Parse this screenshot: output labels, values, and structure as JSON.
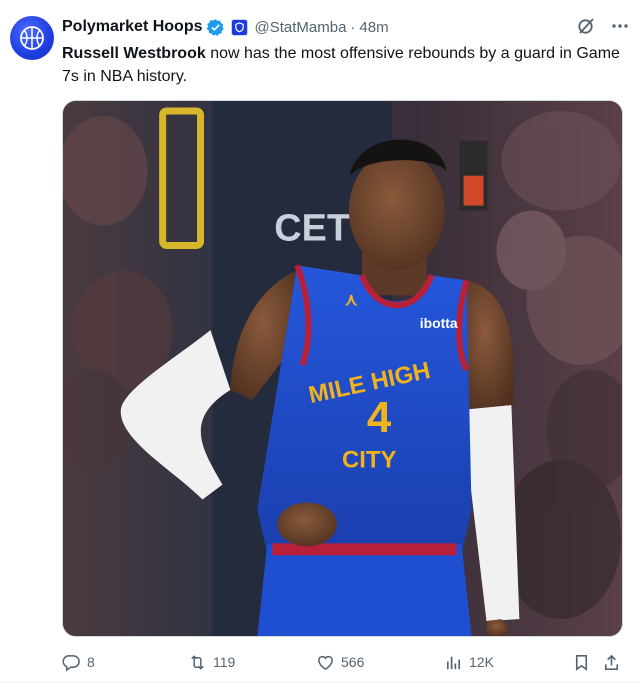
{
  "tweet": {
    "author": {
      "display_name": "Polymarket Hoops",
      "handle": "@StatMamba",
      "separator": "·",
      "time": "48m",
      "avatar_icon": "basketball-icon",
      "verified_icon": "verified-badge-icon",
      "affiliate_icon": "affiliate-badge-icon"
    },
    "text": {
      "mention": "Russell Westbrook",
      "rest": " now has the most offensive rebounds by a guard in Game 7s in NBA history."
    },
    "media": {
      "alt_icon": "photo",
      "jersey_line1": "MILE HIGH",
      "jersey_number": "4",
      "jersey_line2": "CITY",
      "jersey_sponsor": "ibotta",
      "banner_text": "CET"
    },
    "actions": {
      "replies": "8",
      "retweets": "119",
      "likes": "566",
      "views": "12K"
    },
    "colors": {
      "accent": "#1d9bf0",
      "muted": "#536471",
      "jersey_blue": "#1f4fd1",
      "jersey_gold": "#f2b31a",
      "jersey_red": "#b8203a"
    }
  }
}
